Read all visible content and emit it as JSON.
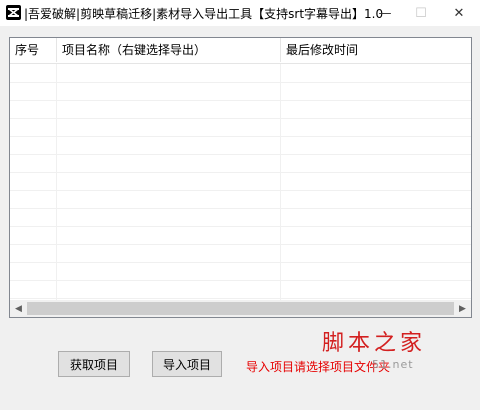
{
  "window": {
    "title": "|吾爱破解|剪映草稿迁移|素材导入导出工具【支持srt字幕导出】1.0",
    "icon": "capcut-logo-icon",
    "min_glyph": "—",
    "max_glyph": "☐",
    "close_glyph": "✕"
  },
  "list": {
    "columns": [
      "序号",
      "项目名称（右键选择导出）",
      "最后修改时间"
    ],
    "rows": []
  },
  "scrollbar": {
    "left_glyph": "◀",
    "right_glyph": "▶"
  },
  "actions": {
    "fetch_label": "获取项目",
    "import_label": "导入项目"
  },
  "hint": "导入项目请选择项目文件夹",
  "watermark": {
    "main": "脚本之家",
    "sub": "51.net"
  },
  "colors": {
    "hint": "#e60000",
    "watermark": "#d32020"
  }
}
